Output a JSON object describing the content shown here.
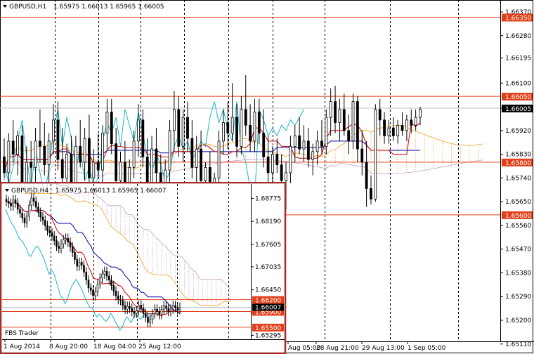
{
  "colors": {
    "frame": "#000000",
    "grid": "#000000",
    "level_line": "#e0401a",
    "level_label_bg": "#e0401a",
    "price_label_bg": "#000000",
    "tenkan": "#cc0000",
    "kijun": "#0000aa",
    "chikou": "#17b7c7",
    "kumo_bear": "#c9a0c9",
    "kumo_bull": "#f0a020",
    "inset_border": "#a52a2a",
    "bid_line": "#c0c0c0"
  },
  "chart_data": [
    {
      "type": "candlestick",
      "name": "main",
      "header": {
        "menu_icon": "triangle-down-icon",
        "symbol_tf": "GBPUSD,H1",
        "ohlc": "1.65975 1.66013 1.65965 1.66005"
      },
      "ylim": [
        1.6512,
        1.6641
      ],
      "y_ticks": [
        "1.66370",
        "1.66280",
        "1.66195",
        "1.66100",
        "1.66005",
        "1.65920",
        "1.65830",
        "1.65740",
        "1.65650",
        "1.65560",
        "1.65470",
        "1.65380",
        "1.65290",
        "1.65200",
        "1.65110"
      ],
      "x_labels": [
        "Aug 05:00",
        "28 Aug 21:00",
        "29 Aug 13:00",
        "1 Sep 05:00"
      ],
      "current_price": "1.66005",
      "levels": [
        "1.66350",
        "1.66050",
        "1.65800",
        "1.65600"
      ],
      "period_separators": 9,
      "candles": [
        [
          1.6582,
          1.6589,
          1.6574,
          1.6576
        ],
        [
          1.6576,
          1.6591,
          1.657,
          1.6588
        ],
        [
          1.6588,
          1.6596,
          1.658,
          1.6583
        ],
        [
          1.6583,
          1.6592,
          1.6575,
          1.659
        ],
        [
          1.659,
          1.6594,
          1.6568,
          1.6572
        ],
        [
          1.6572,
          1.6586,
          1.656,
          1.658
        ],
        [
          1.658,
          1.6588,
          1.6572,
          1.6578
        ],
        [
          1.6578,
          1.6593,
          1.6571,
          1.6588
        ],
        [
          1.6588,
          1.66,
          1.658,
          1.6586
        ],
        [
          1.6586,
          1.6595,
          1.6575,
          1.6579
        ],
        [
          1.6579,
          1.6591,
          1.6571,
          1.6588
        ],
        [
          1.6588,
          1.6602,
          1.6583,
          1.6596
        ],
        [
          1.6596,
          1.6603,
          1.6577,
          1.6581
        ],
        [
          1.6581,
          1.6593,
          1.657,
          1.6574
        ],
        [
          1.6574,
          1.6587,
          1.6568,
          1.6583
        ],
        [
          1.6583,
          1.659,
          1.6565,
          1.657
        ],
        [
          1.657,
          1.659,
          1.6566,
          1.6586
        ],
        [
          1.6586,
          1.6596,
          1.6578,
          1.658
        ],
        [
          1.658,
          1.6593,
          1.6573,
          1.6589
        ],
        [
          1.6589,
          1.6598,
          1.657,
          1.6574
        ],
        [
          1.6574,
          1.6585,
          1.6563,
          1.658
        ],
        [
          1.658,
          1.6591,
          1.6574,
          1.6577
        ],
        [
          1.6577,
          1.6594,
          1.6571,
          1.6591
        ],
        [
          1.6591,
          1.6604,
          1.6585,
          1.6599
        ],
        [
          1.6599,
          1.6604,
          1.6583,
          1.6587
        ],
        [
          1.6587,
          1.6593,
          1.6569,
          1.6573
        ],
        [
          1.6573,
          1.6584,
          1.6563,
          1.658
        ],
        [
          1.658,
          1.6588,
          1.657,
          1.6572
        ],
        [
          1.6572,
          1.6581,
          1.6565,
          1.6578
        ],
        [
          1.6578,
          1.6592,
          1.6574,
          1.6588
        ],
        [
          1.6588,
          1.6602,
          1.6582,
          1.6596
        ],
        [
          1.6596,
          1.66,
          1.6578,
          1.6582
        ],
        [
          1.6582,
          1.6589,
          1.6566,
          1.657
        ],
        [
          1.657,
          1.659,
          1.6565,
          1.6585
        ],
        [
          1.6585,
          1.6593,
          1.6572,
          1.6576
        ],
        [
          1.6576,
          1.6583,
          1.6562,
          1.6568
        ],
        [
          1.6568,
          1.6581,
          1.6562,
          1.6577
        ],
        [
          1.6577,
          1.6596,
          1.6571,
          1.6592
        ],
        [
          1.6592,
          1.6607,
          1.6584,
          1.66
        ],
        [
          1.66,
          1.6605,
          1.6582,
          1.6586
        ],
        [
          1.6586,
          1.66,
          1.658,
          1.6597
        ],
        [
          1.6597,
          1.6603,
          1.6584,
          1.6589
        ],
        [
          1.6589,
          1.6596,
          1.6574,
          1.6578
        ],
        [
          1.6578,
          1.659,
          1.6571,
          1.6585
        ],
        [
          1.6585,
          1.6592,
          1.657,
          1.6573
        ],
        [
          1.6573,
          1.658,
          1.6565,
          1.6578
        ],
        [
          1.6578,
          1.6584,
          1.6568,
          1.6571
        ],
        [
          1.6571,
          1.6576,
          1.6563,
          1.6574
        ],
        [
          1.6574,
          1.6592,
          1.657,
          1.6588
        ],
        [
          1.6588,
          1.66,
          1.6583,
          1.6595
        ],
        [
          1.6595,
          1.6603,
          1.6585,
          1.6591
        ],
        [
          1.6591,
          1.661,
          1.6588,
          1.6597
        ],
        [
          1.6597,
          1.6602,
          1.6582,
          1.6586
        ],
        [
          1.6586,
          1.6605,
          1.6583,
          1.66
        ],
        [
          1.66,
          1.6613,
          1.659,
          1.6594
        ],
        [
          1.6594,
          1.6602,
          1.6584,
          1.6588
        ],
        [
          1.6588,
          1.6604,
          1.6584,
          1.6599
        ],
        [
          1.6599,
          1.6604,
          1.6587,
          1.6591
        ],
        [
          1.6591,
          1.66,
          1.6578,
          1.6582
        ],
        [
          1.6582,
          1.659,
          1.6572,
          1.6576
        ],
        [
          1.6576,
          1.6586,
          1.657,
          1.6583
        ],
        [
          1.6583,
          1.6589,
          1.6576,
          1.6579
        ],
        [
          1.6579,
          1.6583,
          1.657,
          1.6573
        ],
        [
          1.6573,
          1.658,
          1.6562,
          1.6576
        ],
        [
          1.6576,
          1.659,
          1.6572,
          1.6586
        ],
        [
          1.6586,
          1.6594,
          1.658,
          1.659
        ],
        [
          1.659,
          1.6597,
          1.6583,
          1.6585
        ],
        [
          1.6585,
          1.6594,
          1.658,
          1.6588
        ],
        [
          1.6588,
          1.6593,
          1.6578,
          1.6581
        ],
        [
          1.6581,
          1.6587,
          1.6575,
          1.6584
        ],
        [
          1.6584,
          1.6592,
          1.6579,
          1.6588
        ],
        [
          1.6588,
          1.6596,
          1.6583,
          1.6586
        ],
        [
          1.6586,
          1.66,
          1.6583,
          1.6597
        ],
        [
          1.6597,
          1.6608,
          1.659,
          1.6603
        ],
        [
          1.6603,
          1.6609,
          1.6591,
          1.6595
        ],
        [
          1.6595,
          1.6604,
          1.6588,
          1.66
        ],
        [
          1.66,
          1.6606,
          1.659,
          1.6592
        ],
        [
          1.6592,
          1.6598,
          1.6583,
          1.6588
        ],
        [
          1.6588,
          1.6606,
          1.6585,
          1.6603
        ],
        [
          1.6603,
          1.6605,
          1.658,
          1.6585
        ],
        [
          1.6585,
          1.6592,
          1.6575,
          1.658
        ],
        [
          1.658,
          1.6588,
          1.6563,
          1.657
        ],
        [
          1.657,
          1.6575,
          1.6564,
          1.6566
        ],
        [
          1.6566,
          1.6602,
          1.6565,
          1.66
        ],
        [
          1.66,
          1.6604,
          1.659,
          1.6596
        ],
        [
          1.6596,
          1.6599,
          1.6587,
          1.659
        ],
        [
          1.659,
          1.6596,
          1.6587,
          1.6593
        ],
        [
          1.6593,
          1.6597,
          1.6588,
          1.659
        ],
        [
          1.659,
          1.6596,
          1.6587,
          1.6594
        ],
        [
          1.6594,
          1.6599,
          1.659,
          1.6592
        ],
        [
          1.6592,
          1.6598,
          1.6588,
          1.6596
        ],
        [
          1.6596,
          1.66,
          1.6591,
          1.6594
        ],
        [
          1.6594,
          1.66,
          1.6592,
          1.6597
        ],
        [
          1.6597,
          1.6601,
          1.6594,
          1.66
        ]
      ]
    },
    {
      "type": "candlestick",
      "name": "inset",
      "header": {
        "menu_icon": "triangle-down-icon",
        "symbol_tf": "GBPUSD,H4",
        "ohlc": "1.65975 1.66013 1.65965 1.66007"
      },
      "ylim": [
        1.6523,
        1.6905
      ],
      "y_ticks": [
        "1.68775",
        "1.68190",
        "1.67605",
        "1.67035",
        "1.66450",
        "1.65865",
        "1.65295"
      ],
      "x_labels": [
        "1 Aug 2014",
        "8 Aug 20:00",
        "18 Aug 04:00",
        "25 Aug 12:00"
      ],
      "current_price": "1.66007",
      "levels": [
        "1.66200",
        "1.65900",
        "1.65500"
      ],
      "watermark": "FBS Trader",
      "period_separators": 5,
      "closes": [
        1.687,
        1.6865,
        1.6858,
        1.6874,
        1.6866,
        1.685,
        1.684,
        1.6828,
        1.6815,
        1.6832,
        1.686,
        1.6878,
        1.687,
        1.6855,
        1.6842,
        1.683,
        1.6822,
        1.6808,
        1.6795,
        1.679,
        1.6782,
        1.677,
        1.6756,
        1.675,
        1.6762,
        1.6772,
        1.6776,
        1.6766,
        1.6754,
        1.674,
        1.6722,
        1.6705,
        1.6715,
        1.6708,
        1.669,
        1.667,
        1.665,
        1.6644,
        1.663,
        1.664,
        1.666,
        1.6675,
        1.6685,
        1.6692,
        1.668,
        1.667,
        1.6656,
        1.6642,
        1.663,
        1.662,
        1.6618,
        1.6605,
        1.6596,
        1.6603,
        1.6598,
        1.659,
        1.6585,
        1.6592,
        1.6606,
        1.6598,
        1.6585,
        1.6575,
        1.6562,
        1.657,
        1.6584,
        1.6596,
        1.659,
        1.6582,
        1.6595,
        1.6604,
        1.6598,
        1.659,
        1.6596,
        1.6605,
        1.66,
        1.6595,
        1.6601
      ]
    }
  ]
}
